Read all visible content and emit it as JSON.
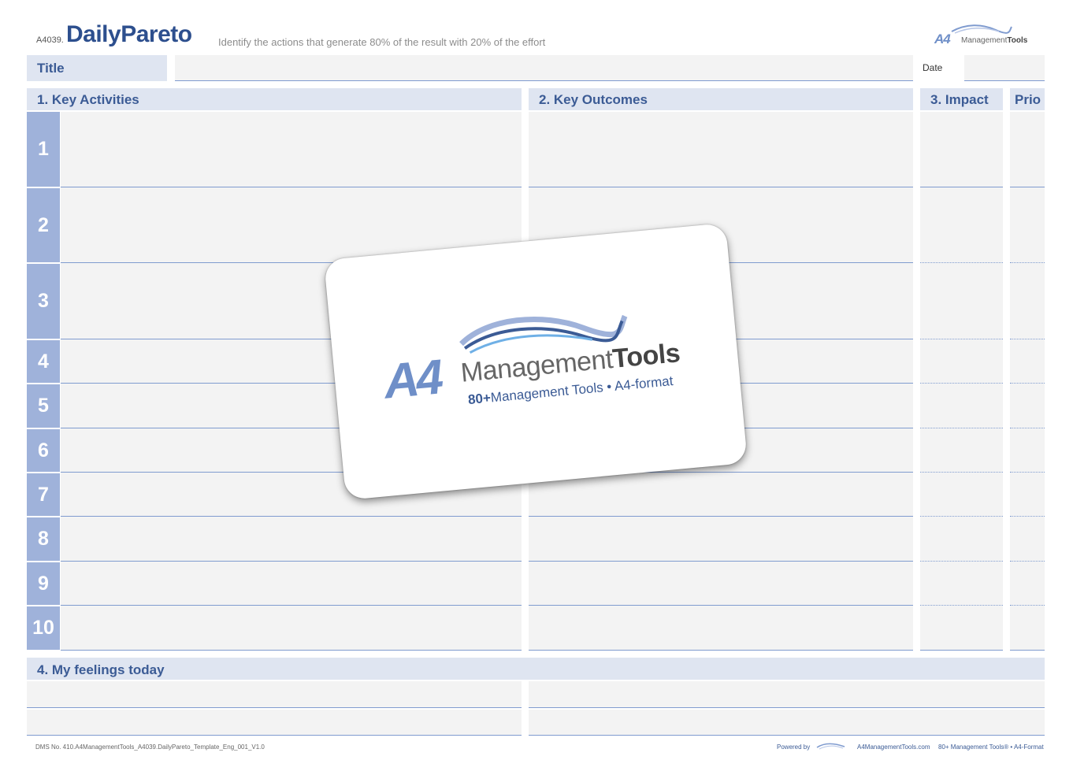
{
  "header": {
    "code": "A4039.",
    "title": "DailyPareto",
    "subtitle": "Identify the actions that generate 80% of the result with 20% of the effort",
    "brand_a4": "A4",
    "brand_management": "Management",
    "brand_tools": "Tools"
  },
  "form": {
    "title_label": "Title",
    "title_value": "",
    "date_label": "Date",
    "date_value": ""
  },
  "sections": {
    "activities": "1. Key Activities",
    "outcomes": "2. Key Outcomes",
    "impact": "3. Impact",
    "prio": "Prio",
    "feelings": "4. My feelings today"
  },
  "rows": [
    "1",
    "2",
    "3",
    "4",
    "5",
    "6",
    "7",
    "8",
    "9",
    "10"
  ],
  "overlay": {
    "logo_a4": "A4",
    "logo_management": "Management",
    "logo_tools": "Tools",
    "logo_count": "80+",
    "logo_tagline": "Management Tools • A4-format"
  },
  "footer": {
    "dms": "DMS No. 410.A4ManagementTools_A4039.DailyPareto_Template_Eng_001_V1.0",
    "powered_by": "Powered by",
    "website": "A4ManagementTools.com",
    "tagline": "80+ Management Tools® • A4-Format"
  },
  "colors": {
    "accent": "#2d4f8e",
    "header_fill": "#dfe5f1",
    "number_fill": "#9fb2da",
    "field_fill": "#f3f3f3",
    "line": "#7f9bcf"
  }
}
